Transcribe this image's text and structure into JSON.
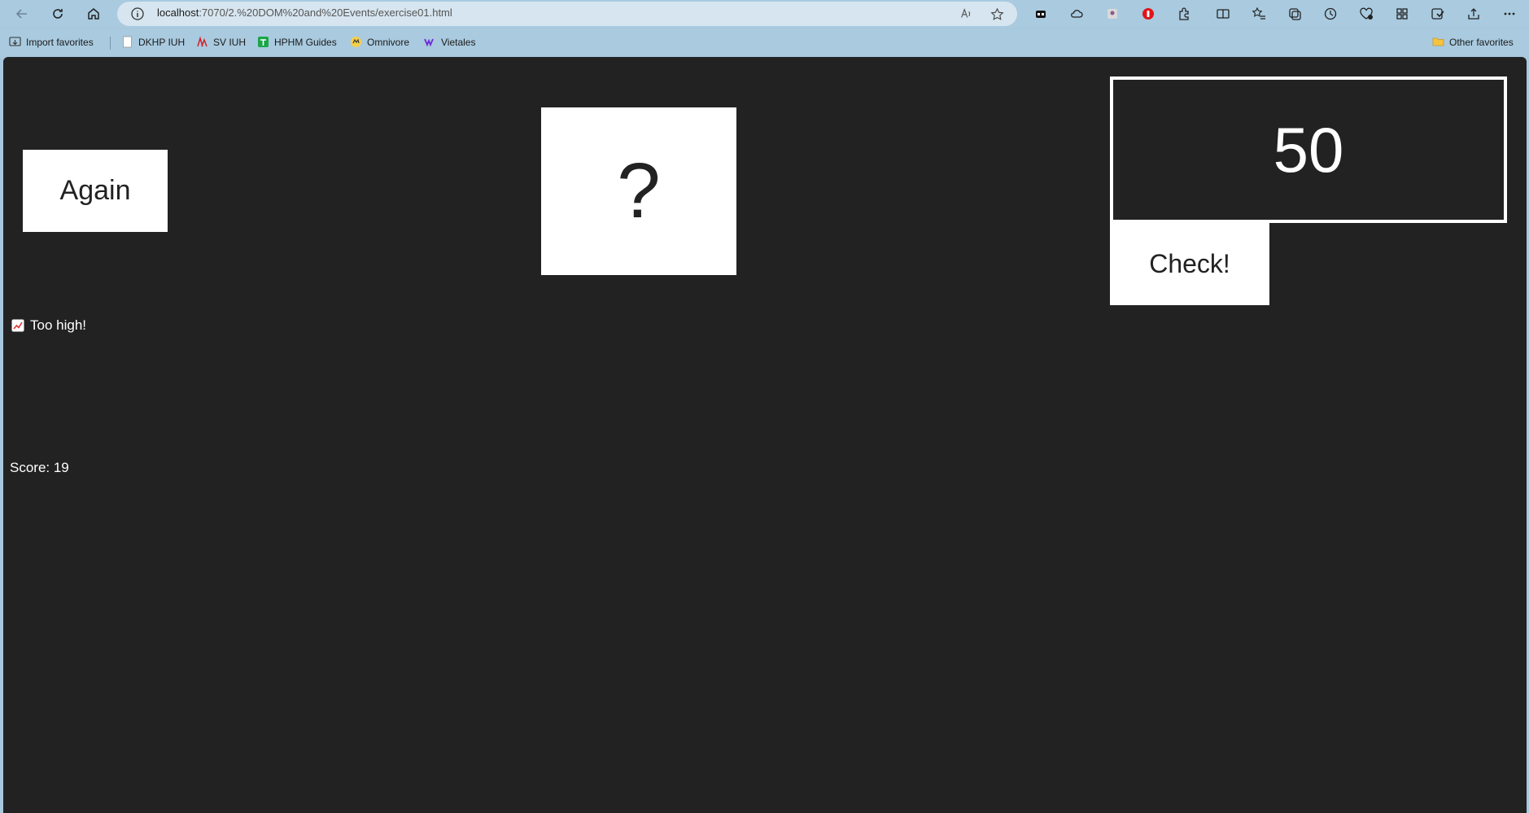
{
  "browser": {
    "url_host": "localhost",
    "url_rest": ":7070/2.%20DOM%20and%20Events/exercise01.html"
  },
  "favorites": [
    {
      "label": "Import favorites",
      "icon": "import-icon"
    },
    {
      "label": "DKHP IUH",
      "icon": "page-icon"
    },
    {
      "label": "SV IUH",
      "icon": "iuh-logo-icon"
    },
    {
      "label": "HPHM Guides",
      "icon": "green-tile-icon"
    },
    {
      "label": "Omnivore",
      "icon": "omnivore-icon"
    },
    {
      "label": "Vietales",
      "icon": "vietales-icon"
    }
  ],
  "other_favorites": "Other favorites",
  "game": {
    "again_label": "Again",
    "secret_label": "?",
    "guess_value": "50",
    "check_label": "Check!",
    "message_text": "Too high!",
    "message_icon": "chart-increasing-icon",
    "score_text": "Score: 19"
  },
  "colors": {
    "page_bg": "#222222",
    "box_bg": "#ffffff",
    "browser_chrome": "#a9cadf"
  }
}
